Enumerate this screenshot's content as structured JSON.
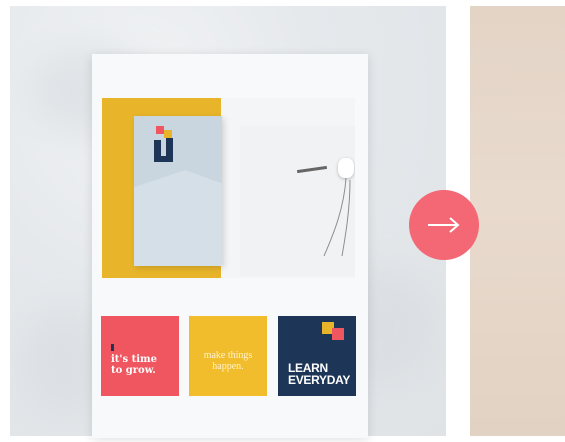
{
  "gallery": {
    "tiles": [
      {
        "lines": "it's time\nto grow."
      },
      {
        "lines": "make things\nhappen."
      },
      {
        "lines": "LEARN\nEVERYDAY"
      }
    ],
    "next_button_icon": "arrow-right-icon"
  },
  "colors": {
    "accent_pink": "#f46774",
    "tile_red": "#f0565f",
    "tile_yellow": "#f2bd2d",
    "tile_navy": "#1d3658",
    "brand_yellow": "#e8b52a"
  }
}
